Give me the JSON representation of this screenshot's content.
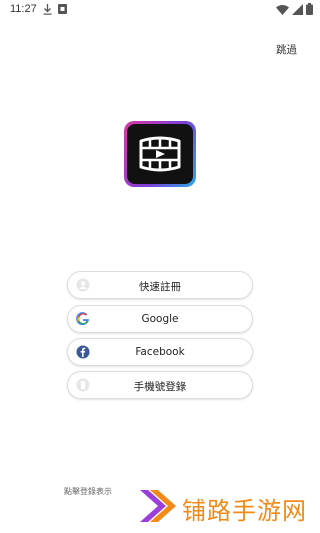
{
  "status_bar": {
    "time": "11:27"
  },
  "header": {
    "skip_label": "跳過"
  },
  "auth": {
    "register_label": "快速註冊",
    "google_label": "Google",
    "facebook_label": "Facebook",
    "phone_label": "手機號登錄"
  },
  "footer": {
    "terms_text": "點擊登錄表示"
  },
  "watermark": {
    "text": "铺路手游网"
  },
  "colors": {
    "google_blue": "#4285F4",
    "facebook_blue": "#3b5998",
    "watermark_orange": "#f28a1a",
    "logo_gradient_pink": "#d93aa3",
    "logo_gradient_blue": "#2aa8e8"
  }
}
